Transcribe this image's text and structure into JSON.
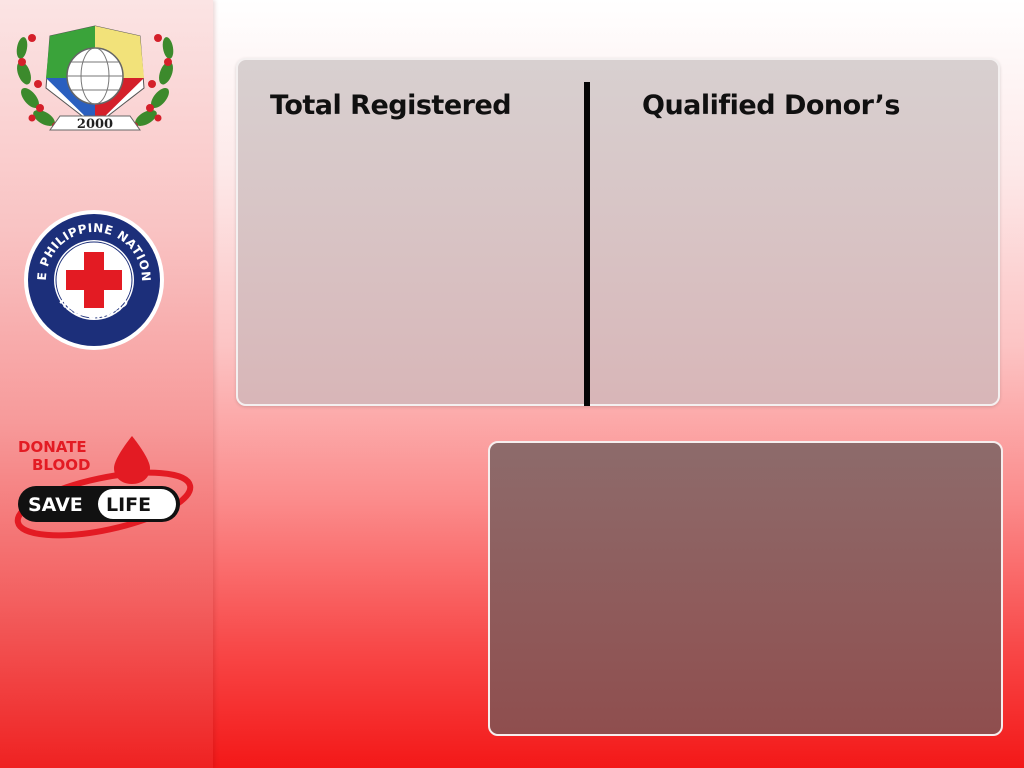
{
  "sidebar": {
    "logos": [
      {
        "icon": "school-emblem-logo",
        "text": "2000"
      },
      {
        "icon": "red-cross-seal-logo",
        "text": "THE PHILIPPINE NATIONAL RED CROSS"
      },
      {
        "icon": "donate-blood-save-life-logo",
        "text": "DONATE BLOOD SAVE LIFE"
      }
    ]
  },
  "main": {
    "top_panel": {
      "left_heading": "Total Registered",
      "right_heading": "Qualified Donor’s"
    }
  },
  "colors": {
    "brand_red": "#e31b23",
    "seal_blue": "#1c2f7a",
    "text_dark": "#101010"
  }
}
